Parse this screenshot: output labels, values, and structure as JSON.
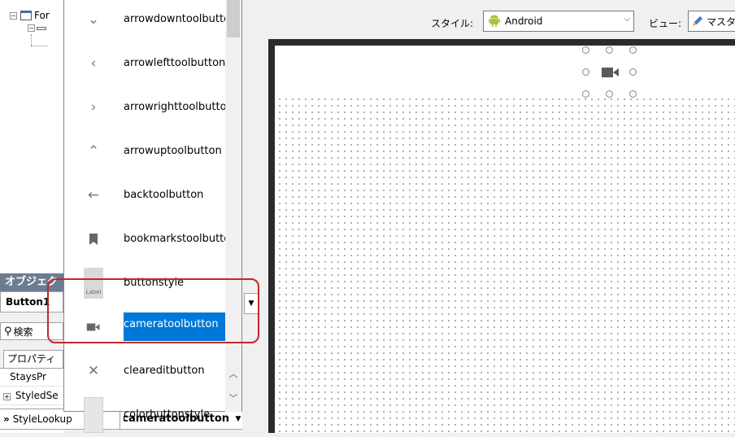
{
  "structure": {
    "form_label": "For"
  },
  "inspector": {
    "title": "オブジェク",
    "component": "Button1",
    "search_placeholder": "検索",
    "tab_label": "プロパティ",
    "properties": [
      {
        "name": "StaysPr"
      },
      {
        "name": "StyledSe"
      },
      {
        "name": "StyleLookup",
        "value": "cameratoolbutton"
      }
    ]
  },
  "style_dropdown": {
    "items": [
      {
        "label": "arrowdowntoolbutton",
        "icon": "chevron-down-icon",
        "glyph": "⌄"
      },
      {
        "label": "arrowlefttoolbutton",
        "icon": "chevron-left-icon",
        "glyph": "‹"
      },
      {
        "label": "arrowrighttoolbutton",
        "icon": "chevron-right-icon",
        "glyph": "›"
      },
      {
        "label": "arrowuptoolbutton",
        "icon": "chevron-up-icon",
        "glyph": "⌃"
      },
      {
        "label": "backtoolbutton",
        "icon": "back-arrow-icon",
        "glyph": "←"
      },
      {
        "label": "bookmarkstoolbutton",
        "icon": "bookmark-icon",
        "glyph": "▮"
      },
      {
        "label": "buttonstyle",
        "icon": "label-button-icon",
        "glyph": "Label"
      },
      {
        "label": "cameratoolbutton",
        "icon": "camera-icon",
        "glyph": "■",
        "selected": true
      },
      {
        "label": "cleareditbutton",
        "icon": "clear-x-icon",
        "glyph": "✕"
      },
      {
        "label": "colorbuttonstyle",
        "icon": "color-button-icon",
        "glyph": ""
      }
    ]
  },
  "designer": {
    "style_label": "スタイル:",
    "style_value": "Android",
    "view_label": "ビュー:",
    "view_value": "マスタ"
  },
  "colors": {
    "selection": "#0078d7",
    "highlight_border": "#c0282a",
    "android_green": "#a4c639"
  }
}
